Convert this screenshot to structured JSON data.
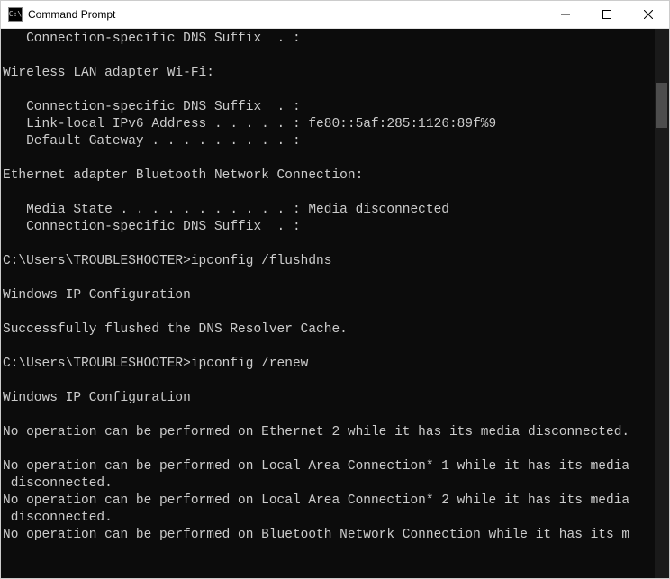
{
  "window": {
    "title": "Command Prompt",
    "icon_label": "cmd-icon"
  },
  "terminal": {
    "lines": [
      "   Connection-specific DNS Suffix  . :",
      "",
      "Wireless LAN adapter Wi-Fi:",
      "",
      "   Connection-specific DNS Suffix  . :",
      "   Link-local IPv6 Address . . . . . : fe80::5af:285:1126:89f%9",
      "   Default Gateway . . . . . . . . . :",
      "",
      "Ethernet adapter Bluetooth Network Connection:",
      "",
      "   Media State . . . . . . . . . . . : Media disconnected",
      "   Connection-specific DNS Suffix  . :",
      "",
      "C:\\Users\\TROUBLESHOOTER>ipconfig /flushdns",
      "",
      "Windows IP Configuration",
      "",
      "Successfully flushed the DNS Resolver Cache.",
      "",
      "C:\\Users\\TROUBLESHOOTER>ipconfig /renew",
      "",
      "Windows IP Configuration",
      "",
      "No operation can be performed on Ethernet 2 while it has its media disconnected.",
      "",
      "No operation can be performed on Local Area Connection* 1 while it has its media",
      " disconnected.",
      "No operation can be performed on Local Area Connection* 2 while it has its media",
      " disconnected.",
      "No operation can be performed on Bluetooth Network Connection while it has its m"
    ]
  }
}
